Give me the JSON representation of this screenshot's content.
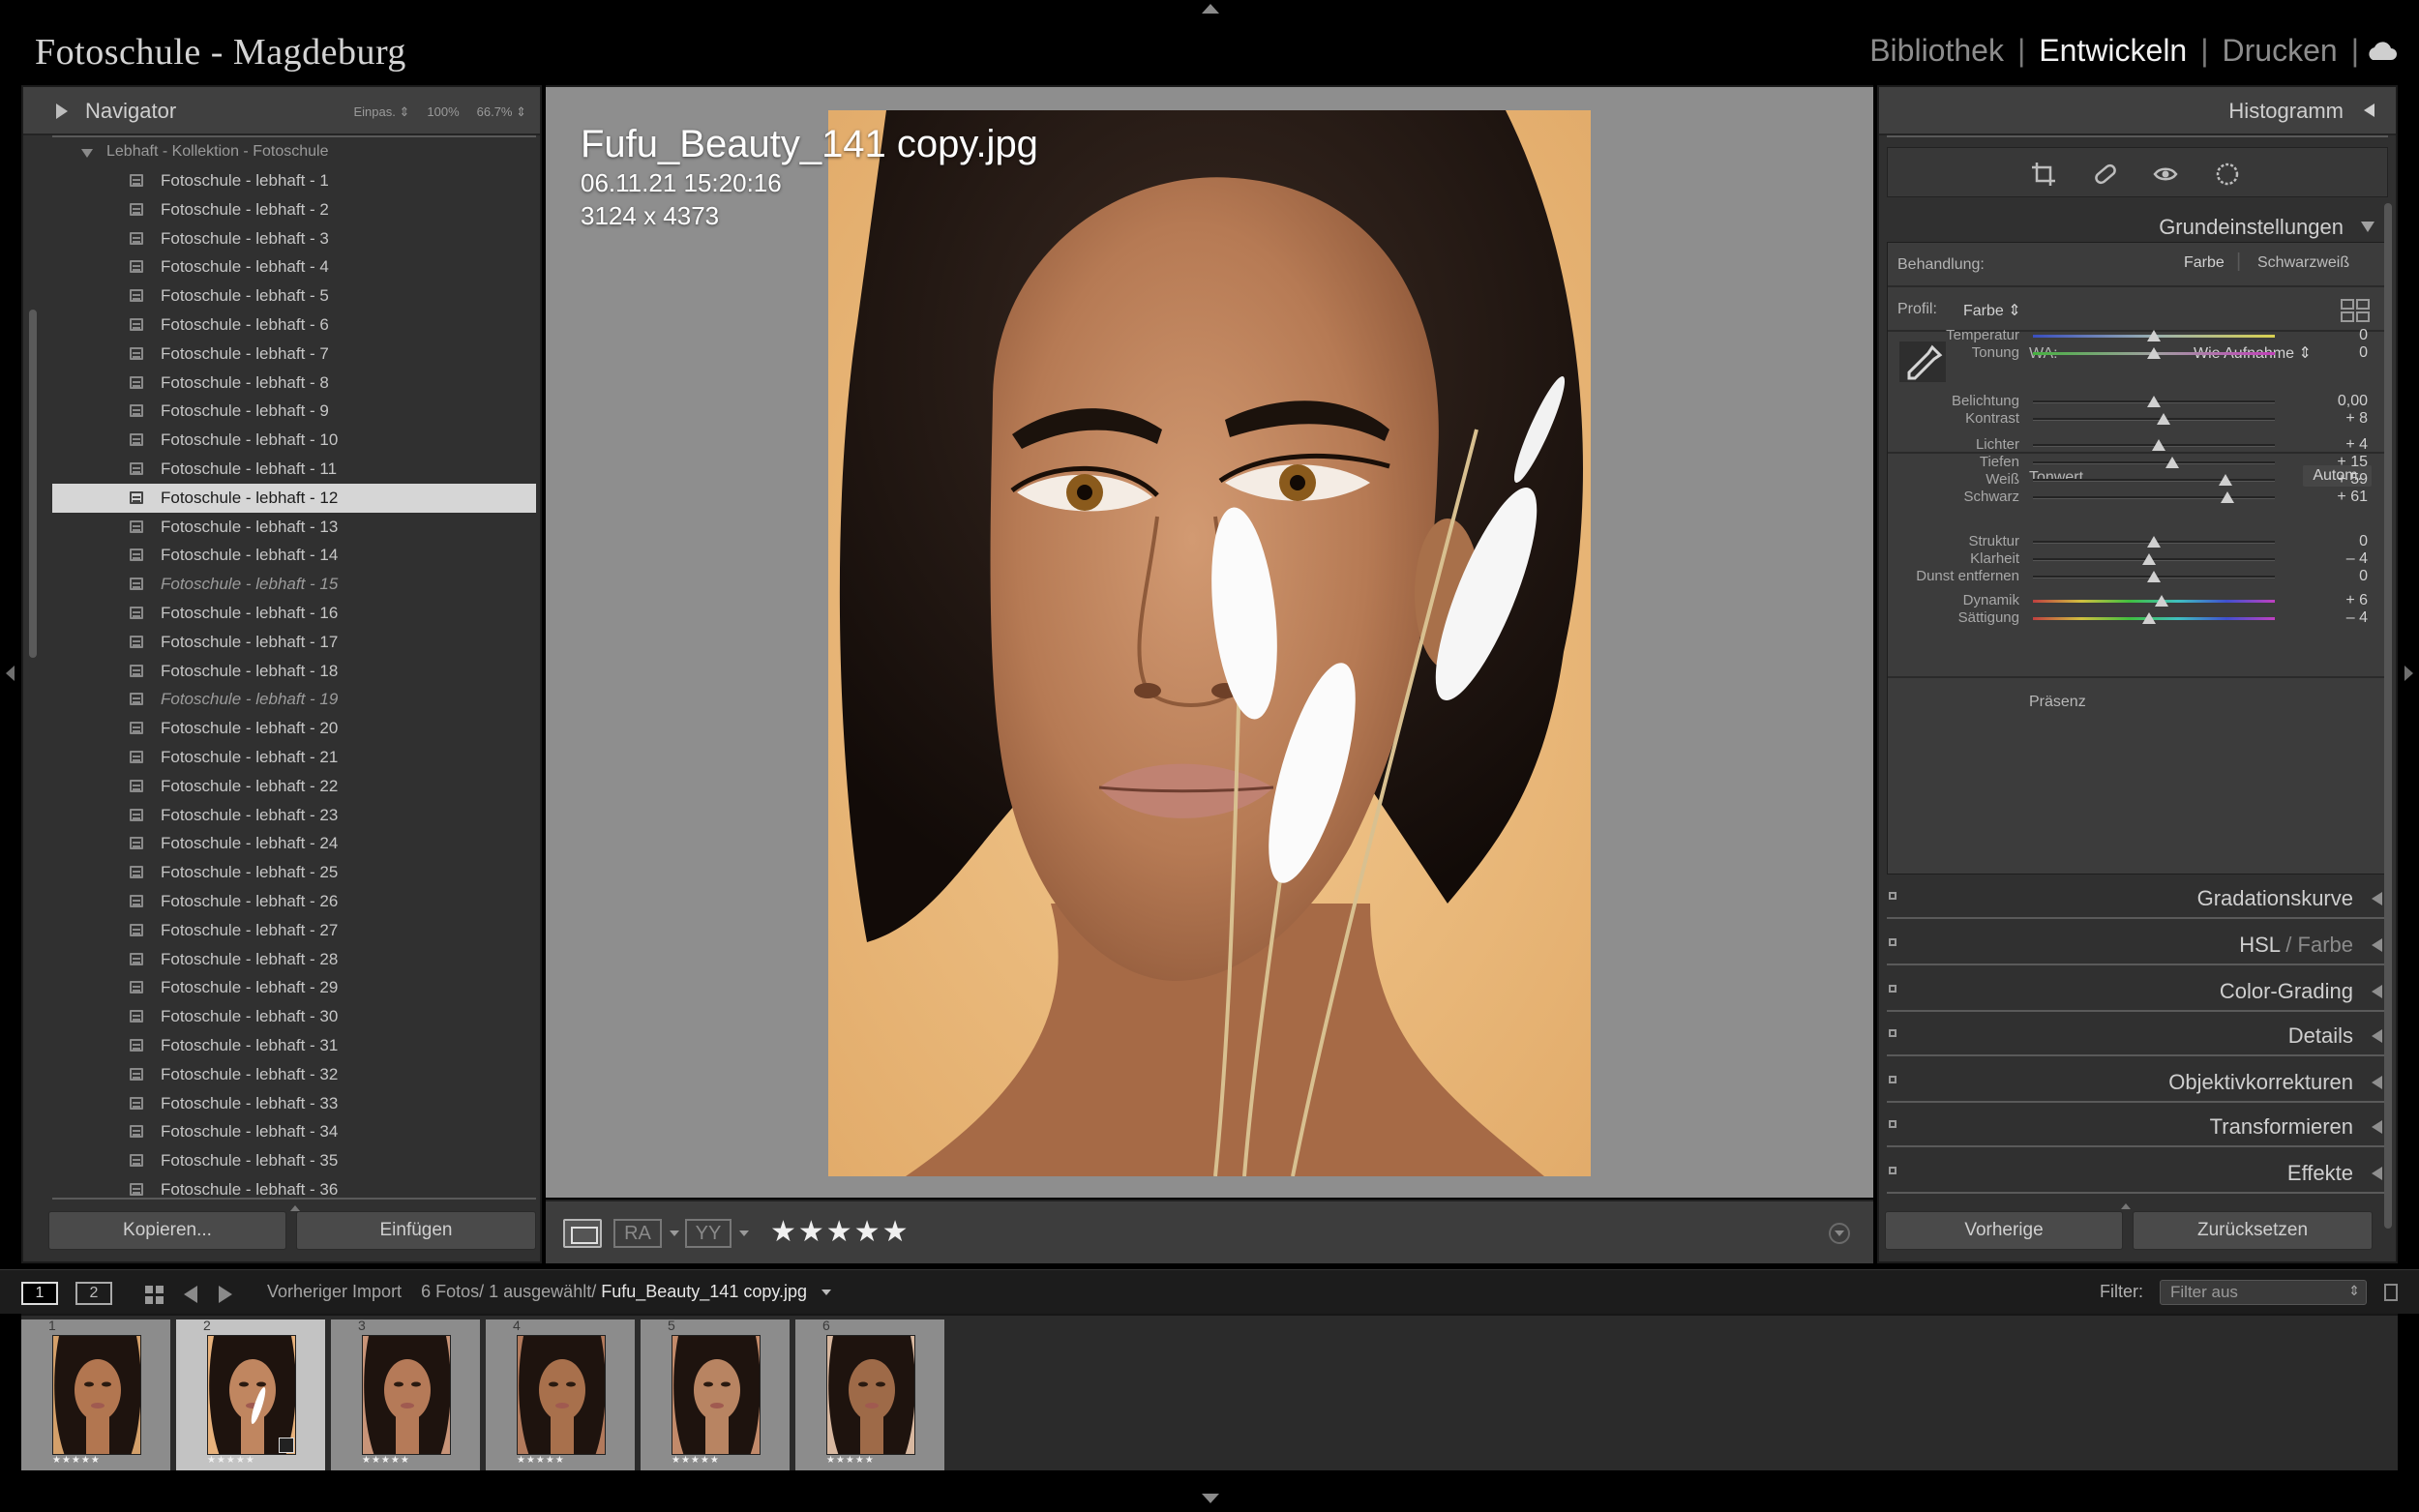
{
  "app": {
    "title": "Fotoschule - Magdeburg",
    "modules": [
      {
        "label": "Bibliothek",
        "active": false
      },
      {
        "label": "Entwickeln",
        "active": true
      },
      {
        "label": "Drucken",
        "active": false
      }
    ]
  },
  "navigator": {
    "title": "Navigator",
    "zoom_fit": "Einpas. ⇕",
    "zoom_100": "100%",
    "zoom_custom": "66.7% ⇕"
  },
  "collection": {
    "title": "Lebhaft - Kollektion - Fotoschule",
    "items": [
      {
        "label": "Fotoschule - lebhaft - 1",
        "state": "normal"
      },
      {
        "label": "Fotoschule - lebhaft - 2",
        "state": "normal"
      },
      {
        "label": "Fotoschule - lebhaft - 3",
        "state": "normal"
      },
      {
        "label": "Fotoschule - lebhaft - 4",
        "state": "normal"
      },
      {
        "label": "Fotoschule - lebhaft - 5",
        "state": "normal"
      },
      {
        "label": "Fotoschule - lebhaft - 6",
        "state": "normal"
      },
      {
        "label": "Fotoschule - lebhaft - 7",
        "state": "normal"
      },
      {
        "label": "Fotoschule - lebhaft - 8",
        "state": "normal"
      },
      {
        "label": "Fotoschule - lebhaft - 9",
        "state": "normal"
      },
      {
        "label": "Fotoschule - lebhaft - 10",
        "state": "normal"
      },
      {
        "label": "Fotoschule - lebhaft - 11",
        "state": "normal"
      },
      {
        "label": "Fotoschule - lebhaft - 12",
        "state": "selected"
      },
      {
        "label": "Fotoschule - lebhaft - 13",
        "state": "normal"
      },
      {
        "label": "Fotoschule - lebhaft - 14",
        "state": "normal"
      },
      {
        "label": "Fotoschule - lebhaft - 15",
        "state": "italic"
      },
      {
        "label": "Fotoschule - lebhaft - 16",
        "state": "normal"
      },
      {
        "label": "Fotoschule - lebhaft - 17",
        "state": "normal"
      },
      {
        "label": "Fotoschule - lebhaft - 18",
        "state": "normal"
      },
      {
        "label": "Fotoschule - lebhaft - 19",
        "state": "italic"
      },
      {
        "label": "Fotoschule - lebhaft - 20",
        "state": "normal"
      },
      {
        "label": "Fotoschule - lebhaft - 21",
        "state": "normal"
      },
      {
        "label": "Fotoschule - lebhaft - 22",
        "state": "normal"
      },
      {
        "label": "Fotoschule - lebhaft - 23",
        "state": "normal"
      },
      {
        "label": "Fotoschule - lebhaft - 24",
        "state": "normal"
      },
      {
        "label": "Fotoschule - lebhaft - 25",
        "state": "normal"
      },
      {
        "label": "Fotoschule - lebhaft - 26",
        "state": "normal"
      },
      {
        "label": "Fotoschule - lebhaft - 27",
        "state": "normal"
      },
      {
        "label": "Fotoschule - lebhaft - 28",
        "state": "normal"
      },
      {
        "label": "Fotoschule - lebhaft - 29",
        "state": "normal"
      },
      {
        "label": "Fotoschule - lebhaft - 30",
        "state": "normal"
      },
      {
        "label": "Fotoschule - lebhaft - 31",
        "state": "normal"
      },
      {
        "label": "Fotoschule - lebhaft - 32",
        "state": "normal"
      },
      {
        "label": "Fotoschule - lebhaft - 33",
        "state": "normal"
      },
      {
        "label": "Fotoschule - lebhaft - 34",
        "state": "normal"
      },
      {
        "label": "Fotoschule - lebhaft - 35",
        "state": "normal"
      },
      {
        "label": "Fotoschule - lebhaft - 36",
        "state": "normal"
      }
    ]
  },
  "left_buttons": {
    "copy": "Kopieren...",
    "paste": "Einfügen"
  },
  "photo": {
    "filename": "Fufu_Beauty_141 copy.jpg",
    "date": "06.11.21 15:20:16",
    "dimensions": "3124 x 4373"
  },
  "toolbar": {
    "ra_label": "RA",
    "yy_label": "YY",
    "stars": "★★★★★"
  },
  "right_panel": {
    "histogram_title": "Histogramm",
    "basic_title": "Grundeinstellungen",
    "treatment_label": "Behandlung:",
    "treatment_color": "Farbe",
    "treatment_bw": "Schwarzweiß",
    "profile_label": "Profil:",
    "profile_value": "Farbe ⇕",
    "wb_label": "WA:",
    "wb_value": "Wie Aufnahme ⇕",
    "tone_label": "Tonwert",
    "auto_label": "Autom.",
    "presence_label": "Präsenz",
    "sliders": [
      {
        "label": "Temperatur",
        "value": "0",
        "pos": 0.5
      },
      {
        "label": "Tonung",
        "value": "0",
        "pos": 0.5
      },
      {
        "label": "Belichtung",
        "value": "0,00",
        "pos": 0.5
      },
      {
        "label": "Kontrast",
        "value": "+ 8",
        "pos": 0.54
      },
      {
        "label": "Lichter",
        "value": "+ 4",
        "pos": 0.52
      },
      {
        "label": "Tiefen",
        "value": "+ 15",
        "pos": 0.575
      },
      {
        "label": "Weiß",
        "value": "+ 59",
        "pos": 0.795
      },
      {
        "label": "Schwarz",
        "value": "+ 61",
        "pos": 0.805
      },
      {
        "label": "Struktur",
        "value": "0",
        "pos": 0.5
      },
      {
        "label": "Klarheit",
        "value": "– 4",
        "pos": 0.48
      },
      {
        "label": "Dunst entfernen",
        "value": "0",
        "pos": 0.5
      },
      {
        "label": "Dynamik",
        "value": "+ 6",
        "pos": 0.53
      },
      {
        "label": "Sättigung",
        "value": "– 4",
        "pos": 0.48
      }
    ],
    "sections": [
      {
        "title": "Gradationskurve",
        "dim": ""
      },
      {
        "title": "HSL",
        "dim": " / Farbe"
      },
      {
        "title": "Color-Grading",
        "dim": ""
      },
      {
        "title": "Details",
        "dim": ""
      },
      {
        "title": "Objektivkorrekturen",
        "dim": ""
      },
      {
        "title": "Transformieren",
        "dim": ""
      },
      {
        "title": "Effekte",
        "dim": ""
      }
    ],
    "prev_button": "Vorherige",
    "reset_button": "Zurücksetzen"
  },
  "filmbar": {
    "monitor1": "1",
    "monitor2": "2",
    "source": "Vorheriger Import",
    "count": "6 Fotos/",
    "selected": "1 ausgewählt/",
    "current": "Fufu_Beauty_141 copy.jpg",
    "filter_label": "Filter:",
    "filter_value": "Filter aus"
  },
  "filmstrip": [
    {
      "num": "1",
      "stars": "★★★★★",
      "selected": false
    },
    {
      "num": "2",
      "stars": "★★★★★",
      "selected": true
    },
    {
      "num": "3",
      "stars": "★★★★★",
      "selected": false
    },
    {
      "num": "4",
      "stars": "★★★★★",
      "selected": false
    },
    {
      "num": "5",
      "stars": "★★★★★",
      "selected": false
    },
    {
      "num": "6",
      "stars": "★★★★★",
      "selected": false
    }
  ],
  "colors": {
    "panel": "#303030",
    "canvas": "#8e8e8e",
    "selected_row": "#d6d6d6"
  }
}
